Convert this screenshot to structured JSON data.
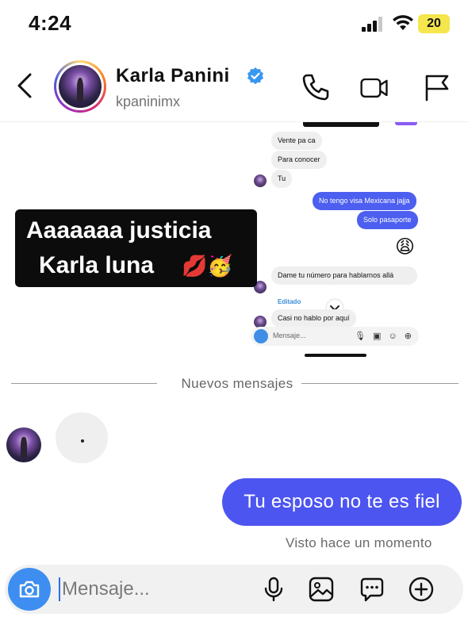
{
  "status_bar": {
    "time": "4:24",
    "battery": "20"
  },
  "header": {
    "name": "Karla  Panini",
    "handle": "kpaninimx"
  },
  "shared_story": {
    "messages": [
      {
        "text": "Vente pa ca",
        "dir": "in"
      },
      {
        "text": "Para conocer",
        "dir": "in"
      },
      {
        "text": "Tu",
        "dir": "in"
      },
      {
        "text": "No tengo visa Mexicana jajja",
        "dir": "out"
      },
      {
        "text": "Solo pasaporte",
        "dir": "out"
      },
      {
        "text": "😩",
        "dir": "out"
      },
      {
        "text": "Dame tu número para hablarnos allá",
        "dir": "in"
      },
      {
        "text": "Casi no hablo por aquí",
        "dir": "in"
      }
    ],
    "edited_label": "Editado",
    "input_placeholder": "Mensaje..."
  },
  "caption": {
    "line1": "Aaaaaaa justicia",
    "line2": "Karla luna",
    "emojis": "💋🥳"
  },
  "divider_label": "Nuevos mensajes",
  "typing_indicator": ".",
  "outgoing_message": "Tu esposo no te es fiel",
  "seen_label": "Visto hace un momento",
  "composer": {
    "placeholder": "Mensaje..."
  },
  "colors": {
    "outgoing_bubble": "#4d55f0",
    "camera_button": "#3d8ef0",
    "verified_badge": "#3897f0",
    "battery": "#f4e64c"
  },
  "icons": [
    "chevron-left-icon",
    "phone-icon",
    "video-camera-icon",
    "flag-icon",
    "camera-icon",
    "microphone-icon",
    "image-icon",
    "sticker-icon",
    "plus-circle-icon",
    "verified-badge-icon"
  ]
}
